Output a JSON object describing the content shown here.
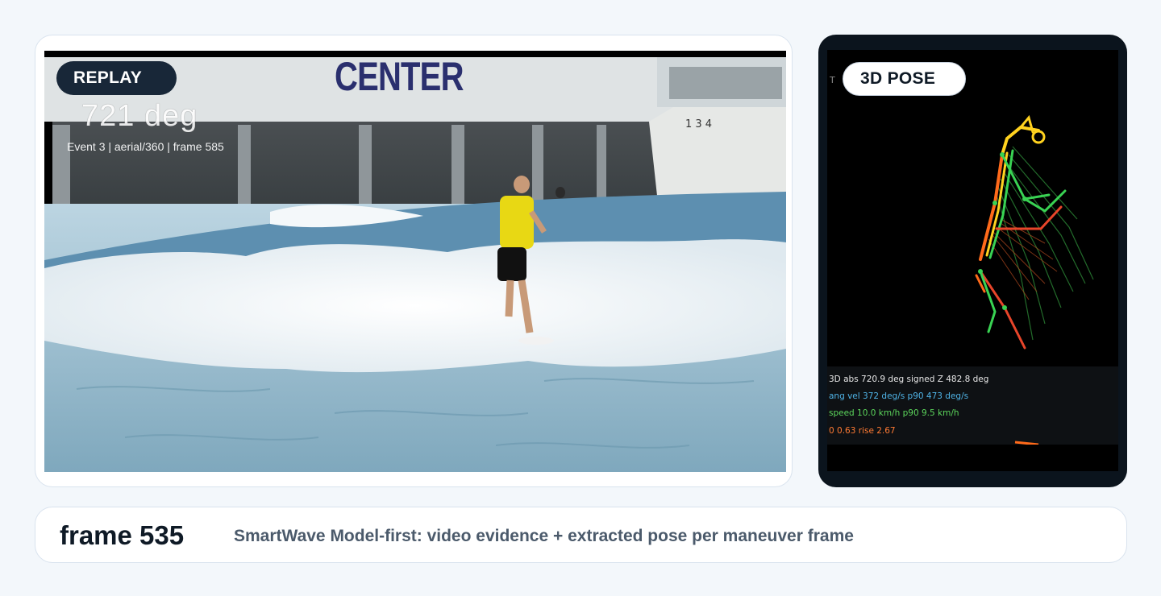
{
  "video_panel": {
    "badge": "REPLAY",
    "overlay_rotation": "721 deg",
    "overlay_event": "Event 3 | aerial/360 | frame 585",
    "background_sign": "CENTER"
  },
  "pose_panel": {
    "badge": "3D POSE",
    "stats": [
      {
        "text": "3D abs 720.9 deg   signed Z 482.8 deg",
        "color": "#e8e8e8"
      },
      {
        "text": "ang vel   372 deg/s   p90   473 deg/s",
        "color": "#4fb3e6"
      },
      {
        "text": "speed  10.0 km/h   p90   9.5 km/h",
        "color": "#5cd65c"
      },
      {
        "text": "0 0.63   rise 2.67",
        "color": "#ff7a33"
      }
    ],
    "colors": {
      "yellow": "#ffd21f",
      "orange": "#ff6a1a",
      "green": "#39d353",
      "red": "#e8452a"
    }
  },
  "footer": {
    "frame_label": "frame 535",
    "caption": "SmartWave Model-first: video evidence + extracted pose per maneuver frame"
  }
}
